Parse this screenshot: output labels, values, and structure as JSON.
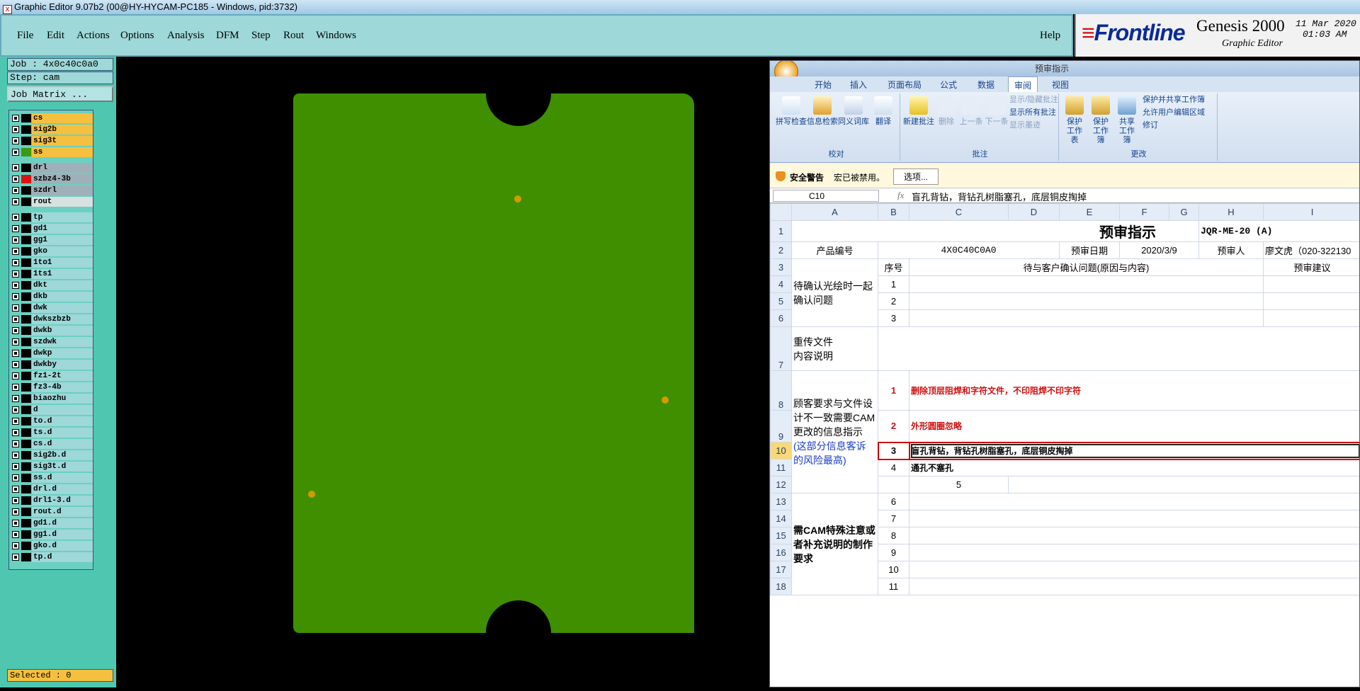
{
  "window": {
    "title": "Graphic Editor 9.07b2 (00@HY-HYCAM-PC185 - Windows, pid:3732)"
  },
  "menu": {
    "items": [
      "File",
      "Edit",
      "Actions",
      "Options",
      "Analysis",
      "DFM",
      "Step",
      "Rout",
      "Windows"
    ],
    "help": "Help"
  },
  "brand": {
    "logo_text": "Frontline",
    "product": "Genesis 2000",
    "subtitle": "Graphic Editor",
    "date": "11 Mar 2020",
    "time": "01:03 AM"
  },
  "job": {
    "job_label": "Job : 4x0c40c0a0",
    "step_label": "Step: cam",
    "matrix_button": "Job Matrix ..."
  },
  "layers": [
    {
      "name": "cs",
      "bg": "#f5c040",
      "sw": "#000"
    },
    {
      "name": "sig2b",
      "bg": "#f5c040",
      "sw": "#000"
    },
    {
      "name": "sig3t",
      "bg": "#f5c040",
      "sw": "#000"
    },
    {
      "name": "ss",
      "bg": "#f5c040",
      "sw": "#3a9a10"
    },
    {
      "name": "drl",
      "bg": "#a0b0b8",
      "sw": "#000"
    },
    {
      "name": "szbz4-3b",
      "bg": "#a0b0b8",
      "sw": "#e01010"
    },
    {
      "name": "szdrl",
      "bg": "#a0b0b8",
      "sw": "#000"
    },
    {
      "name": "rout",
      "bg": "#d8e0e0",
      "sw": "#000"
    },
    {
      "name": "tp",
      "bg": "#9ed8d8",
      "sw": "#000"
    },
    {
      "name": "gd1",
      "bg": "#9ed8d8",
      "sw": "#000"
    },
    {
      "name": "gg1",
      "bg": "#9ed8d8",
      "sw": "#000"
    },
    {
      "name": "gko",
      "bg": "#9ed8d8",
      "sw": "#000"
    },
    {
      "name": "1to1",
      "bg": "#9ed8d8",
      "sw": "#000"
    },
    {
      "name": "1ts1",
      "bg": "#9ed8d8",
      "sw": "#000"
    },
    {
      "name": "dkt",
      "bg": "#9ed8d8",
      "sw": "#000"
    },
    {
      "name": "dkb",
      "bg": "#9ed8d8",
      "sw": "#000"
    },
    {
      "name": "dwk",
      "bg": "#9ed8d8",
      "sw": "#000"
    },
    {
      "name": "dwkszbzb",
      "bg": "#9ed8d8",
      "sw": "#000"
    },
    {
      "name": "dwkb",
      "bg": "#9ed8d8",
      "sw": "#000"
    },
    {
      "name": "szdwk",
      "bg": "#9ed8d8",
      "sw": "#000"
    },
    {
      "name": "dwkp",
      "bg": "#9ed8d8",
      "sw": "#000"
    },
    {
      "name": "dwkby",
      "bg": "#9ed8d8",
      "sw": "#000"
    },
    {
      "name": "fz1-2t",
      "bg": "#9ed8d8",
      "sw": "#000"
    },
    {
      "name": "fz3-4b",
      "bg": "#9ed8d8",
      "sw": "#000"
    },
    {
      "name": "biaozhu",
      "bg": "#9ed8d8",
      "sw": "#000"
    },
    {
      "name": "d",
      "bg": "#9ed8d8",
      "sw": "#000"
    },
    {
      "name": "to.d",
      "bg": "#9ed8d8",
      "sw": "#000"
    },
    {
      "name": "ts.d",
      "bg": "#9ed8d8",
      "sw": "#000"
    },
    {
      "name": "cs.d",
      "bg": "#9ed8d8",
      "sw": "#000"
    },
    {
      "name": "sig2b.d",
      "bg": "#9ed8d8",
      "sw": "#000"
    },
    {
      "name": "sig3t.d",
      "bg": "#9ed8d8",
      "sw": "#000"
    },
    {
      "name": "ss.d",
      "bg": "#9ed8d8",
      "sw": "#000"
    },
    {
      "name": "drl.d",
      "bg": "#9ed8d8",
      "sw": "#000"
    },
    {
      "name": "drl1-3.d",
      "bg": "#9ed8d8",
      "sw": "#000"
    },
    {
      "name": "rout.d",
      "bg": "#9ed8d8",
      "sw": "#000"
    },
    {
      "name": "gd1.d",
      "bg": "#9ed8d8",
      "sw": "#000"
    },
    {
      "name": "gg1.d",
      "bg": "#9ed8d8",
      "sw": "#000"
    },
    {
      "name": "gko.d",
      "bg": "#9ed8d8",
      "sw": "#000"
    },
    {
      "name": "tp.d",
      "bg": "#9ed8d8",
      "sw": "#000"
    }
  ],
  "status": {
    "selected": "Selected : 0"
  },
  "board": {
    "fill": "#3f8f00",
    "pad": "#d49a00"
  },
  "excel": {
    "title": "预审指示",
    "tabs": [
      "开始",
      "插入",
      "页面布局",
      "公式",
      "数据",
      "审阅",
      "视图"
    ],
    "active_tab": "审阅",
    "ribbon": {
      "proof": {
        "label": "校对",
        "buttons": [
          "拼写检查",
          "信息检索",
          "同义词库",
          "翻译"
        ]
      },
      "comments": {
        "label": "批注",
        "buttons": [
          "新建批注",
          "删除",
          "上一条",
          "下一条"
        ],
        "small": [
          "显示/隐藏批注",
          "显示所有批注",
          "显示墨迹"
        ]
      },
      "changes": {
        "label": "更改",
        "buttons": [
          "保护工作表",
          "保护工作簿",
          "共享工作簿"
        ],
        "small": [
          "保护并共享工作簿",
          "允许用户编辑区域",
          "修订"
        ]
      }
    },
    "security": {
      "warning": "安全警告",
      "message": "宏已被禁用。",
      "options": "选项..."
    },
    "namebox": "C10",
    "formula": "盲孔背钻，背钻孔树脂塞孔，底层铜皮掏掉",
    "fx": "fx",
    "columns": [
      "A",
      "B",
      "C",
      "D",
      "E",
      "F",
      "G",
      "H",
      "I"
    ],
    "row_numbers": [
      "1",
      "2",
      "3",
      "4",
      "5",
      "6",
      "7",
      "8",
      "9",
      "10",
      "11",
      "12",
      "13",
      "14",
      "15",
      "16",
      "17",
      "18"
    ],
    "doc_code": "JQR-ME-20 (A)",
    "product_label": "产品编号",
    "product_value": "4X0C40C0A0",
    "date_label": "预审日期",
    "date_value": "2020/3/9",
    "reviewer_label": "预审人",
    "reviewer_value": "廖文虎（020-322130",
    "seq_header": "序号",
    "issue_header": "待与客户确认问题(原因与内容)",
    "suggest_header": "预审建议",
    "sec1": "待确认光绘时一起确认问题",
    "sec2": "重传文件\n内容说明",
    "sec3_a": "顾客要求与文件设计不一致需要CAM更改的信息指示",
    "sec3_b": "(这部分信息客诉的风险最高)",
    "sec4": "需CAM特殊注意或者补充说明的制作要求",
    "seq": [
      "1",
      "2",
      "3",
      "1",
      "2",
      "3",
      "4",
      "5",
      "6",
      "7",
      "8",
      "9",
      "10",
      "11"
    ],
    "items": [
      "删除顶层阻焊和字符文件，不印阻焊不印字符",
      "外形圆圈忽略",
      "盲孔背钻，背钻孔树脂塞孔，底层铜皮掏掉",
      "通孔不塞孔"
    ]
  }
}
